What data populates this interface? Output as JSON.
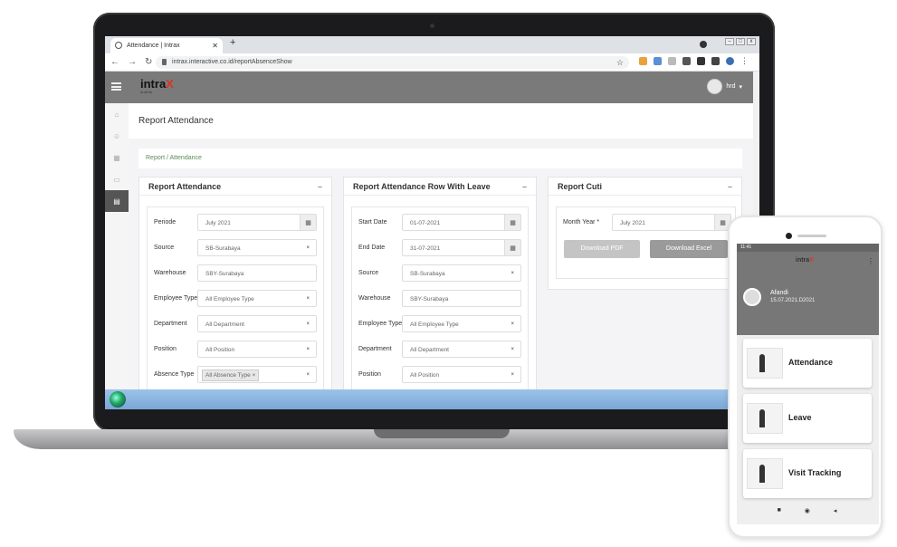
{
  "browser": {
    "tab_title": "Attendance | Intrax",
    "url": "intrax.interactive.co.id/reportAbsenceShow"
  },
  "app": {
    "logo": "intra",
    "logo_x": "X",
    "logo_sub": "mobile",
    "user": "hrd"
  },
  "page": {
    "title": "Report Attendance",
    "breadcrumb": [
      "Report",
      "Attendance"
    ]
  },
  "cards": [
    {
      "title": "Report Attendance",
      "rows": [
        {
          "label": "Periode",
          "value": "July 2021"
        },
        {
          "label": "Source",
          "value": "SB-Surabaya"
        },
        {
          "label": "Warehouse",
          "value": "SBY-Surabaya"
        },
        {
          "label": "Employee Type",
          "value": "All Employee Type"
        },
        {
          "label": "Department",
          "value": "All Department"
        },
        {
          "label": "Position",
          "value": "All Position"
        },
        {
          "label": "Absence Type",
          "value": "All Absence Type"
        }
      ]
    },
    {
      "title": "Report Attendance Row With Leave",
      "rows": [
        {
          "label": "Start Date",
          "value": "01-07-2021"
        },
        {
          "label": "End Date",
          "value": "31-07-2021"
        },
        {
          "label": "Source",
          "value": "SB-Surabaya"
        },
        {
          "label": "Warehouse",
          "value": "SBY-Surabaya"
        },
        {
          "label": "Employee Type",
          "value": "All Employee Type"
        },
        {
          "label": "Department",
          "value": "All Department"
        },
        {
          "label": "Position",
          "value": "All Position"
        }
      ]
    },
    {
      "title": "Report Cuti",
      "rows": [
        {
          "label": "Month Year *",
          "value": "July 2021"
        }
      ],
      "buttons": [
        "Download PDF",
        "Download Excel"
      ]
    }
  ],
  "phone": {
    "time": "11:41",
    "logo": "intra",
    "logo_x": "X",
    "name": "Afandi",
    "id": "15.07.2021.D2021",
    "menu": [
      "Attendance",
      "Leave",
      "Visit Tracking"
    ]
  }
}
